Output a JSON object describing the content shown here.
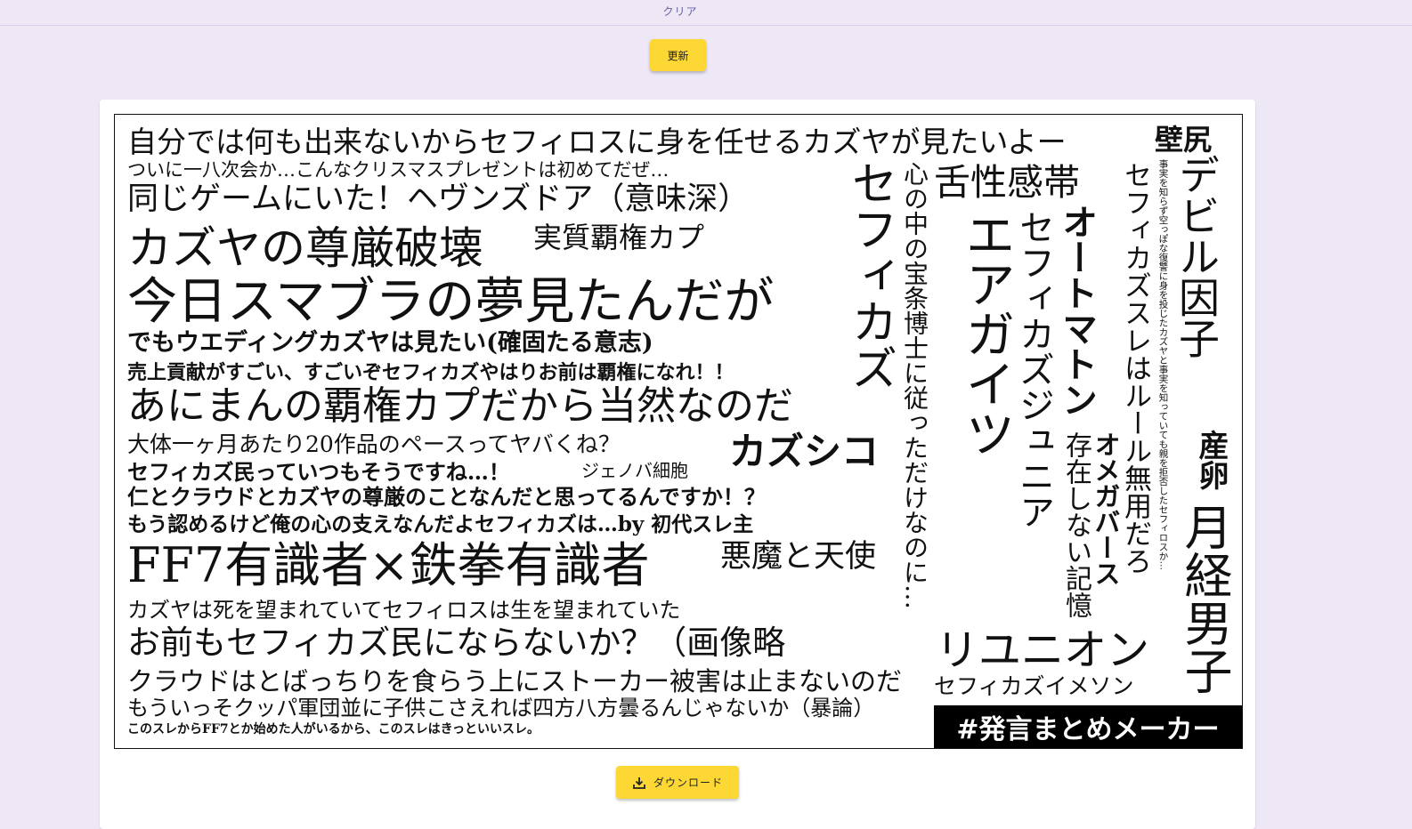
{
  "toolbar": {
    "clear_label": "クリア",
    "update_label": "更新",
    "download_label": "ダウンロード"
  },
  "icons": {
    "download": "download-icon"
  },
  "colors": {
    "background": "#ede7f6",
    "button": "#fdd835",
    "card": "#ffffff",
    "badge_bg": "#000000",
    "badge_text": "#ffffff"
  },
  "cloud": {
    "phrases": [
      "自分では何も出来ないからセフィロスに身を任せるカズヤが見たいよー",
      "ついに一八次会か…こんなクリスマスプレゼントは初めてだぜ…",
      "同じゲームにいた！ヘヴンズドア（意味深）",
      "カズヤの尊厳破壊",
      "実質覇権カプ",
      "今日スマブラの夢見たんだが",
      "でもウエディングカズヤは見たい(確固たる意志)",
      "売上貢献がすごい、すごいぞセフィカズやはりお前は覇権になれ！！",
      "あにまんの覇権カプだから当然なのだ",
      "大体一ヶ月あたり20作品のペースってヤバくね？",
      "カズシコ",
      "セフィカズ民っていつもそうですね…！",
      "ジェノバ細胞",
      "仁とクラウドとカズヤの尊厳のことなんだと思ってるんですか！？",
      "もう認めるけど俺の心の支えなんだよセフィカズは…by 初代スレ主",
      "FF7有識者×鉄拳有識者",
      "悪魔と天使",
      "カズヤは死を望まれていてセフィロスは生を望まれていた",
      "お前もセフィカズ民にならないか？（画像略",
      "クラウドはとばっちりを食らう上にストーカー被害は止まないのだ",
      "もういっそクッパ軍団並に子供こさえれば四方八方曇るんじゃないか（暴論）",
      "このスレからFF7とか始めた人がいるから、このスレはきっといいスレ。",
      "壁尻",
      "セフィカズ",
      "心の中の宝条博士に従っただけなのに…",
      "舌性感帯",
      "エアガイツ",
      "セフィカズジュニア",
      "オートマトン",
      "存在しない記憶",
      "セフィカズスレはルール無用だろ",
      "オメガバース",
      "事実を知らず空っぽな復讐に身を投じたカズヤと事実を知っていても親を拒否したセフィロスか…",
      "デビル因子",
      "産卵",
      "月経男子",
      "リユニオン",
      "セフィカズイメソン"
    ],
    "badge": "#発言まとめメーカー"
  }
}
